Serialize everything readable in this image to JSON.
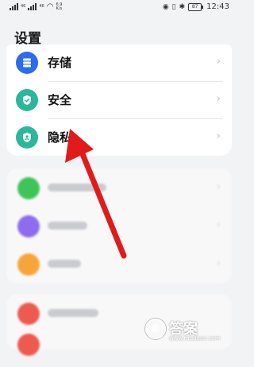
{
  "status_bar": {
    "carrier_left": "46",
    "carrier_right": "46",
    "speed_value": "6.9",
    "speed_unit": "K/s",
    "battery": "87",
    "time": "12:43"
  },
  "page": {
    "title": "设置"
  },
  "settings": {
    "items": [
      {
        "label": "存储",
        "icon": "storage-icon",
        "color": "#2b6af3"
      },
      {
        "label": "安全",
        "icon": "shield-check-icon",
        "color": "#2bb79a"
      },
      {
        "label": "隐私",
        "icon": "privacy-shield-icon",
        "color": "#2bb79a"
      }
    ]
  },
  "blurred_rows": [
    {
      "color": "#3fc45a"
    },
    {
      "color": "#8d6cf0"
    },
    {
      "color": "#f7a43b"
    },
    {
      "color": "#ee5a4f"
    }
  ],
  "watermark": {
    "logo": "赤",
    "text": "答案",
    "domain": "www.mudaan.com"
  },
  "annotation": {
    "arrow_color": "#e01b1b"
  }
}
